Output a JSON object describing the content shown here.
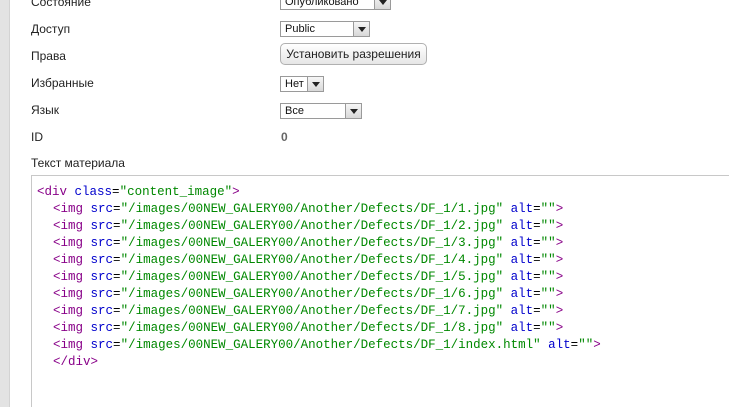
{
  "form": {
    "state": {
      "label": "Состояние",
      "value": "Опубликовано"
    },
    "access": {
      "label": "Доступ",
      "value": "Public"
    },
    "rights": {
      "label": "Права",
      "button_label": "Установить разрешения"
    },
    "featured": {
      "label": "Избранные",
      "value": "Нет"
    },
    "language": {
      "label": "Язык",
      "value": "Все"
    },
    "id": {
      "label": "ID",
      "value": "0"
    },
    "content_label": "Текст материала"
  },
  "editor": {
    "lines": [
      {
        "indent": 0,
        "open": "<div",
        "attrs": [
          {
            "name": "class",
            "value": "\"content_image\""
          }
        ],
        "close": ">"
      },
      {
        "indent": 1,
        "open": "<img",
        "attrs": [
          {
            "name": "src",
            "value": "\"/images/00NEW_GALERY00/Another/Defects/DF_1/1.jpg\""
          },
          {
            "name": "alt",
            "value": "\"\""
          }
        ],
        "close": ">"
      },
      {
        "indent": 1,
        "open": "<img",
        "attrs": [
          {
            "name": "src",
            "value": "\"/images/00NEW_GALERY00/Another/Defects/DF_1/2.jpg\""
          },
          {
            "name": "alt",
            "value": "\"\""
          }
        ],
        "close": ">"
      },
      {
        "indent": 1,
        "open": "<img",
        "attrs": [
          {
            "name": "src",
            "value": "\"/images/00NEW_GALERY00/Another/Defects/DF_1/3.jpg\""
          },
          {
            "name": "alt",
            "value": "\"\""
          }
        ],
        "close": ">"
      },
      {
        "indent": 1,
        "open": "<img",
        "attrs": [
          {
            "name": "src",
            "value": "\"/images/00NEW_GALERY00/Another/Defects/DF_1/4.jpg\""
          },
          {
            "name": "alt",
            "value": "\"\""
          }
        ],
        "close": ">"
      },
      {
        "indent": 1,
        "open": "<img",
        "attrs": [
          {
            "name": "src",
            "value": "\"/images/00NEW_GALERY00/Another/Defects/DF_1/5.jpg\""
          },
          {
            "name": "alt",
            "value": "\"\""
          }
        ],
        "close": ">"
      },
      {
        "indent": 1,
        "open": "<img",
        "attrs": [
          {
            "name": "src",
            "value": "\"/images/00NEW_GALERY00/Another/Defects/DF_1/6.jpg\""
          },
          {
            "name": "alt",
            "value": "\"\""
          }
        ],
        "close": ">"
      },
      {
        "indent": 1,
        "open": "<img",
        "attrs": [
          {
            "name": "src",
            "value": "\"/images/00NEW_GALERY00/Another/Defects/DF_1/7.jpg\""
          },
          {
            "name": "alt",
            "value": "\"\""
          }
        ],
        "close": ">"
      },
      {
        "indent": 1,
        "open": "<img",
        "attrs": [
          {
            "name": "src",
            "value": "\"/images/00NEW_GALERY00/Another/Defects/DF_1/8.jpg\""
          },
          {
            "name": "alt",
            "value": "\"\""
          }
        ],
        "close": ">"
      },
      {
        "indent": 1,
        "open": "<img",
        "attrs": [
          {
            "name": "src",
            "value": "\"/images/00NEW_GALERY00/Another/Defects/DF_1/index.html\""
          },
          {
            "name": "alt",
            "value": "\"\""
          }
        ],
        "close": ">"
      },
      {
        "indent": 1,
        "open": "</div",
        "attrs": [],
        "close": ">"
      }
    ]
  },
  "colors": {
    "tag": "#880088",
    "attribute": "#0000cc",
    "value": "#008800"
  }
}
